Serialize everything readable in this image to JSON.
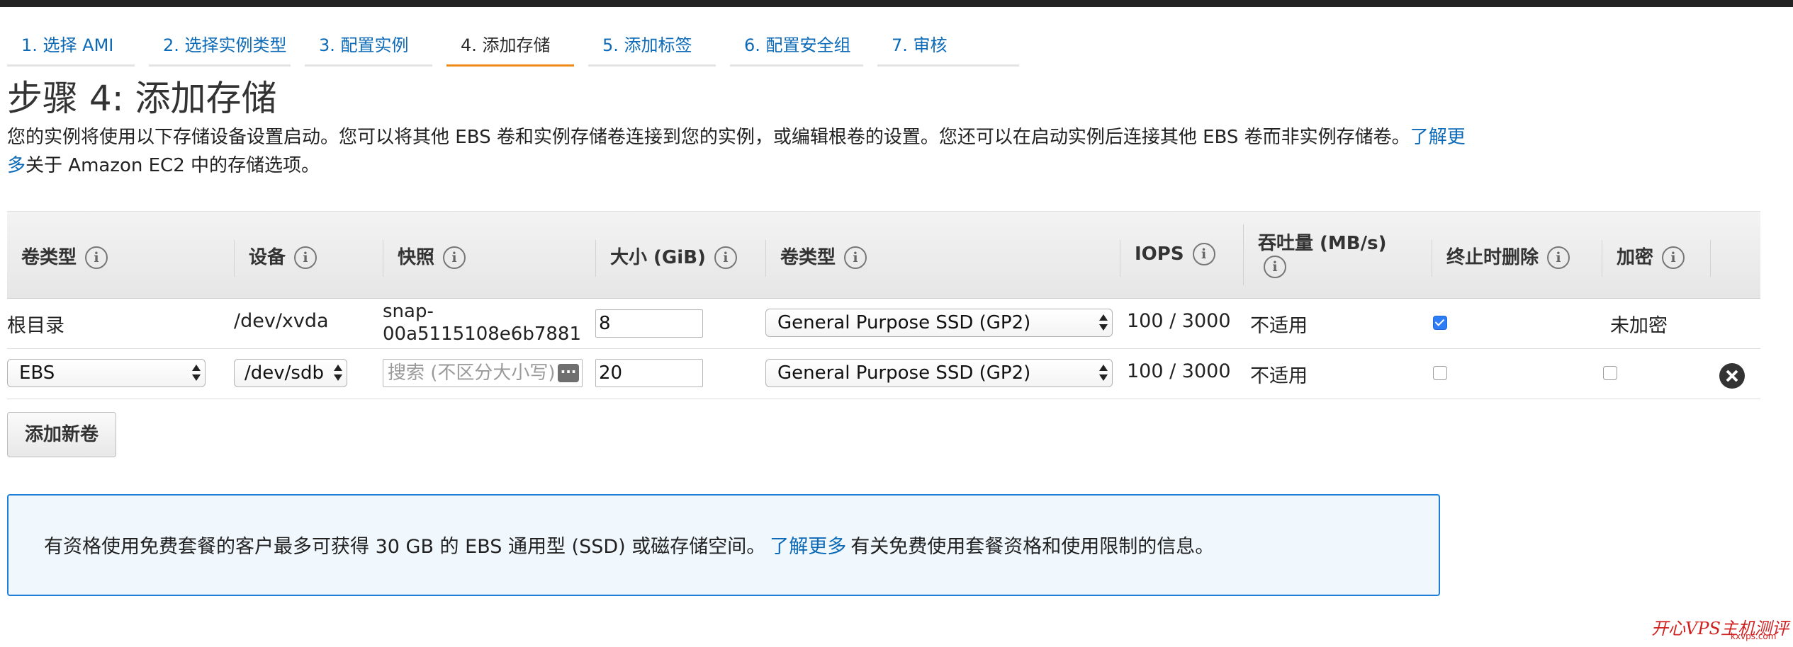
{
  "tabs": [
    {
      "label": "1. 选择 AMI"
    },
    {
      "label": "2. 选择实例类型"
    },
    {
      "label": "3. 配置实例"
    },
    {
      "label": "4. 添加存储"
    },
    {
      "label": "5. 添加标签"
    },
    {
      "label": "6. 配置安全组"
    },
    {
      "label": "7. 审核"
    }
  ],
  "active_tab": "4. 添加存储",
  "page": {
    "title": "步骤 4: 添加存储",
    "desc_before": "您的实例将使用以下存储设备设置启动。您可以将其他 EBS 卷和实例存储卷连接到您的实例，或编辑根卷的设置。您还可以在启动实例后连接其他 EBS 卷而非实例存储卷。",
    "learn_more": "了解更多",
    "desc_after": "关于 Amazon EC2 中的存储选项。"
  },
  "table": {
    "headers": {
      "volume_type": "卷类型",
      "device": "设备",
      "snapshot": "快照",
      "size": "大小 (GiB)",
      "volume_kind": "卷类型",
      "iops": "IOPS",
      "throughput": "吞吐量 (MB/s)",
      "delete_on_term": "终止时删除",
      "encryption": "加密"
    },
    "rows": [
      {
        "volume_type": "根目录",
        "device": "/dev/xvda",
        "snapshot": "snap-00a5115108e6b7881",
        "size": "8",
        "volume_kind": "General Purpose SSD (GP2)",
        "iops": "100 / 3000",
        "throughput": "不适用",
        "delete_on_term": true,
        "encryption": "未加密"
      },
      {
        "volume_type": "EBS",
        "device": "/dev/sdb",
        "snapshot_placeholder": "搜索 (不区分大小写)",
        "size": "20",
        "volume_kind": "General Purpose SSD (GP2)",
        "iops": "100 / 3000",
        "throughput": "不适用",
        "delete_on_term": false,
        "encryption": false
      }
    ]
  },
  "buttons": {
    "add_volume": "添加新卷"
  },
  "notice": {
    "before": "有资格使用免费套餐的客户最多可获得 30 GB 的 EBS 通用型 (SSD) 或磁存储空间。",
    "link": "了解更多",
    "after": "有关免费使用套餐资格和使用限制的信息。"
  },
  "watermark": {
    "text": "开心VPS主机测评",
    "url": "kxvps.com"
  },
  "icons": {
    "info": "info-icon",
    "remove": "remove-circle-icon",
    "select_arrows": "select-arrows-icon",
    "more": "ellipsis-icon"
  },
  "colors": {
    "link": "#0d6ab7",
    "active_tab_underline": "#ef8b1d",
    "notice_border": "#1f7fd8",
    "notice_bg": "#f0f7fd",
    "checkbox_checked": "#2e7cf6",
    "watermark": "#d21f1f"
  }
}
